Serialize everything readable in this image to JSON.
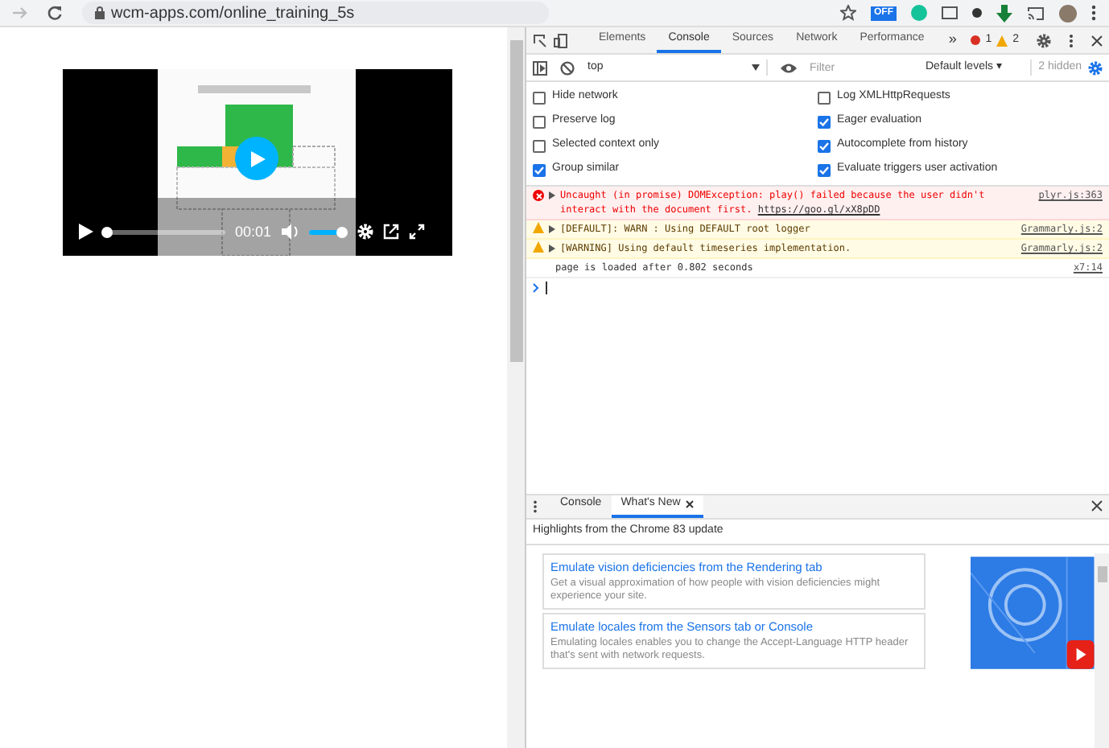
{
  "browser": {
    "url": "wcm-apps.com/online_training_5s",
    "extension_badge": "OFF"
  },
  "video": {
    "progress": {
      "level": 0.03
    },
    "time": "00:01",
    "volume": {
      "level": 0.85
    }
  },
  "devtools": {
    "tabs": [
      {
        "label": "Elements",
        "selected": false
      },
      {
        "label": "Console",
        "selected": true
      },
      {
        "label": "Sources",
        "selected": false
      },
      {
        "label": "Network",
        "selected": false
      },
      {
        "label": "Performance",
        "selected": false
      }
    ],
    "more": "»",
    "error_count": "1",
    "warning_count": "2",
    "console_toolbar": {
      "context": "top",
      "filter_placeholder": "Filter",
      "levels": "Default levels ▾",
      "hidden": "2 hidden"
    },
    "settings": [
      {
        "label": "Hide network",
        "checked": false
      },
      {
        "label": "Log XMLHttpRequests",
        "checked": false
      },
      {
        "label": "Preserve log",
        "checked": false
      },
      {
        "label": "Eager evaluation",
        "checked": true
      },
      {
        "label": "Selected context only",
        "checked": false
      },
      {
        "label": "Autocomplete from history",
        "checked": true
      },
      {
        "label": "Group similar",
        "checked": true
      },
      {
        "label": "Evaluate triggers user activation",
        "checked": true
      }
    ],
    "messages": [
      {
        "kind": "error",
        "text": "Uncaught (in promise) DOMException: play() failed because the user didn't interact with the document first.",
        "link": "https://goo.gl/xX8pDD",
        "source": "plyr.js:363"
      },
      {
        "kind": "warning",
        "text": "[DEFAULT]: WARN : Using DEFAULT root logger",
        "source": "Grammarly.js:2"
      },
      {
        "kind": "warning",
        "text": "[WARNING] Using default timeseries implementation.",
        "source": "Grammarly.js:2"
      },
      {
        "kind": "log",
        "text": "page is loaded after 0.802 seconds",
        "source": "x7:14"
      }
    ],
    "drawer": {
      "tabs": [
        {
          "label": "Console",
          "selected": false,
          "closable": false
        },
        {
          "label": "What's New",
          "selected": true,
          "closable": true
        }
      ],
      "heading": "Highlights from the Chrome 83 update",
      "cards": [
        {
          "title": "Emulate vision deficiencies from the Rendering tab",
          "text": "Get a visual approximation of how people with vision deficiencies might experience your site."
        },
        {
          "title": "Emulate locales from the Sensors tab or Console",
          "text": "Emulating locales enables you to change the Accept-Language HTTP header that's sent with network requests."
        }
      ]
    }
  }
}
